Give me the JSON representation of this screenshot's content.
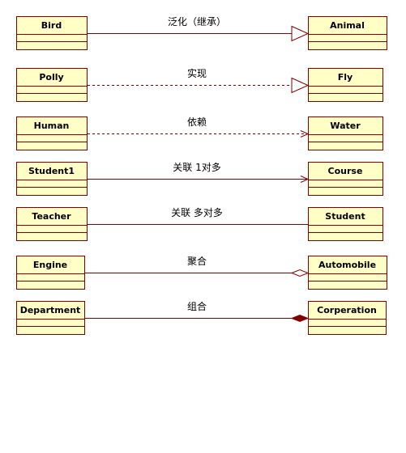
{
  "colors": {
    "box_fill": "#ffffc6",
    "box_stroke": "#800000",
    "line": "#800000",
    "text": "#000000"
  },
  "relations": [
    {
      "from": "Bird",
      "to": "Animal",
      "label": "泛化（继承）",
      "line": "solid",
      "head": "hollow-triangle"
    },
    {
      "from": "Polly",
      "to": "Fly",
      "label": "实现",
      "line": "dashed",
      "head": "hollow-triangle"
    },
    {
      "from": "Human",
      "to": "Water",
      "label": "依赖",
      "line": "dashed",
      "head": "open-arrow"
    },
    {
      "from": "Student1",
      "to": "Course",
      "label": "关联 1对多",
      "line": "solid",
      "head": "open-arrow"
    },
    {
      "from": "Teacher",
      "to": "Student",
      "label": "关联 多对多",
      "line": "solid",
      "head": "none"
    },
    {
      "from": "Engine",
      "to": "Automobile",
      "label": "聚合",
      "line": "solid",
      "head": "hollow-diamond"
    },
    {
      "from": "Department",
      "to": "Corperation",
      "label": "组合",
      "line": "solid",
      "head": "filled-diamond"
    }
  ]
}
